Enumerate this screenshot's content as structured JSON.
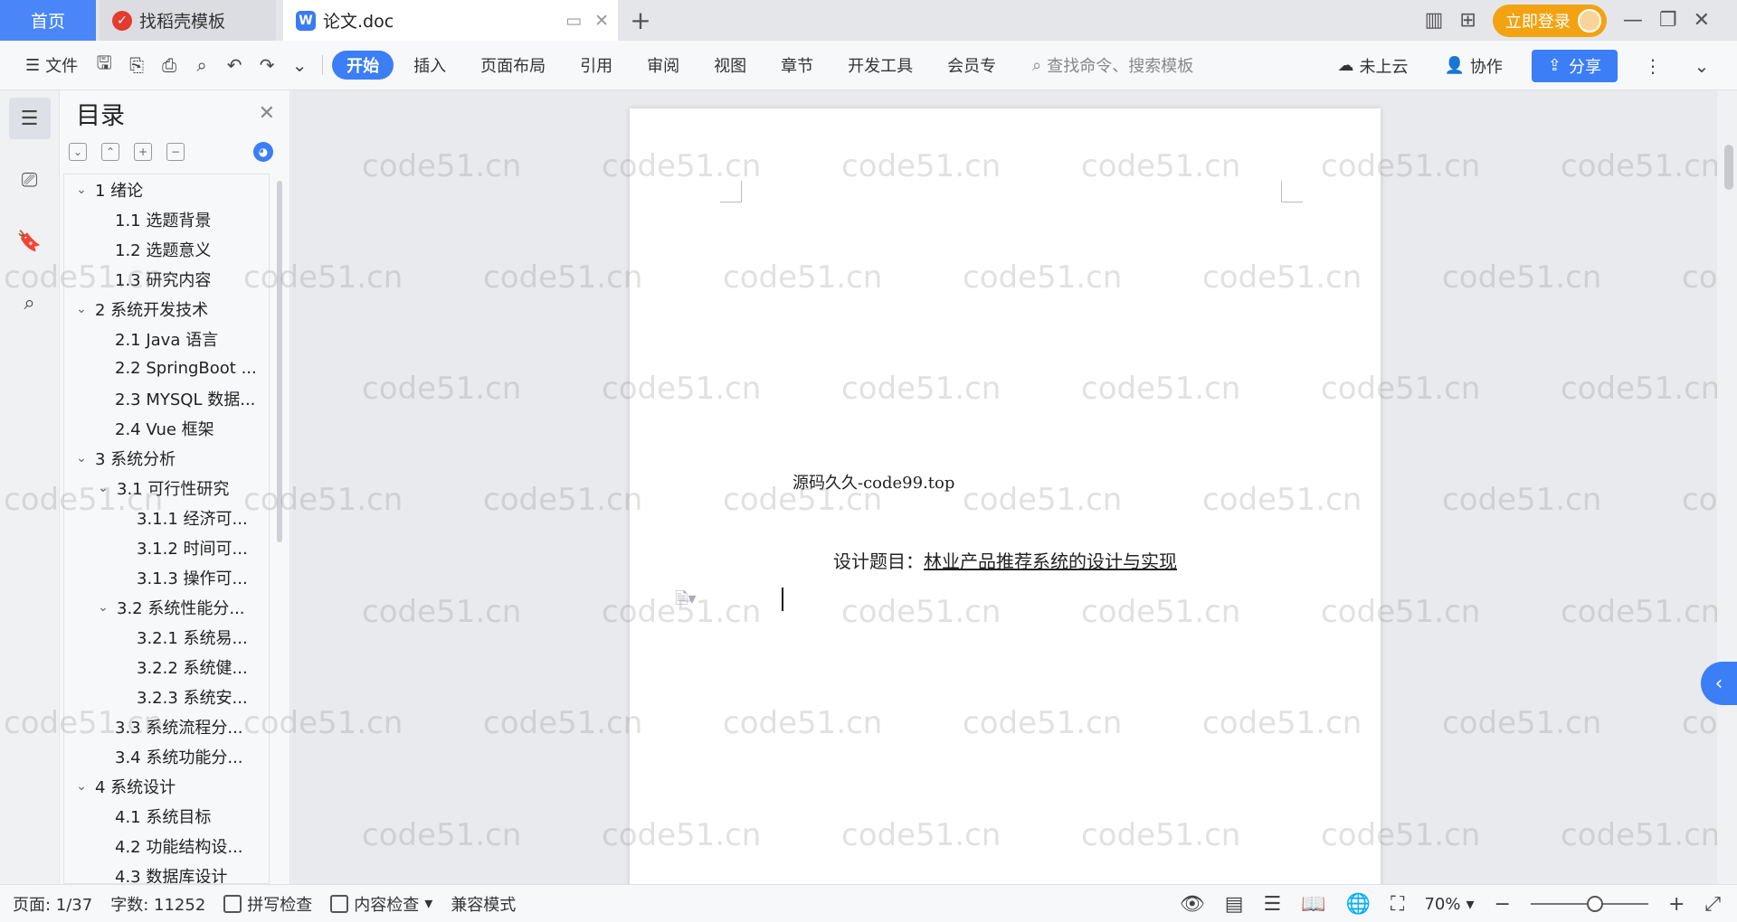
{
  "tabs": {
    "home": "首页",
    "template": "找稻壳模板",
    "doc": "论文.doc"
  },
  "titlebar": {
    "login": "立即登录"
  },
  "toolbar": {
    "file": "文件",
    "menu_tabs": [
      "开始",
      "插入",
      "页面布局",
      "引用",
      "审阅",
      "视图",
      "章节",
      "开发工具",
      "会员专"
    ],
    "search_placeholder": "查找命令、搜索模板",
    "cloud": "未上云",
    "collab": "协作",
    "share": "分享"
  },
  "toc": {
    "title": "目录",
    "items": [
      {
        "level": 1,
        "expanded": true,
        "text": "1  绪论"
      },
      {
        "level": 2,
        "text": "1.1  选题背景"
      },
      {
        "level": 2,
        "text": "1.2  选题意义"
      },
      {
        "level": 2,
        "text": "1.3  研究内容"
      },
      {
        "level": 1,
        "expanded": true,
        "text": "2  系统开发技术"
      },
      {
        "level": 2,
        "text": "2.1 Java 语言"
      },
      {
        "level": 2,
        "text": "2.2 SpringBoot ..."
      },
      {
        "level": 2,
        "text": "2.3 MYSQL 数据..."
      },
      {
        "level": 2,
        "text": "2.4 Vue 框架"
      },
      {
        "level": 1,
        "expanded": true,
        "text": "3  系统分析"
      },
      {
        "level": 2,
        "expanded": true,
        "text": "3.1 可行性研究"
      },
      {
        "level": 3,
        "text": "3.1.1 经济可..."
      },
      {
        "level": 3,
        "text": "3.1.2 时间可..."
      },
      {
        "level": 3,
        "text": "3.1.3 操作可..."
      },
      {
        "level": 2,
        "expanded": true,
        "text": "3.2 系统性能分..."
      },
      {
        "level": 3,
        "text": "3.2.1 系统易..."
      },
      {
        "level": 3,
        "text": "3.2.2 系统健..."
      },
      {
        "level": 3,
        "text": "3.2.3 系统安..."
      },
      {
        "level": 2,
        "text": "3.3  系统流程分..."
      },
      {
        "level": 2,
        "text": "3.4 系统功能分..."
      },
      {
        "level": 1,
        "expanded": true,
        "text": "4  系统设计"
      },
      {
        "level": 2,
        "text": "4.1 系统目标"
      },
      {
        "level": 2,
        "text": "4.2 功能结构设..."
      },
      {
        "level": 2,
        "text": "4.3 数据库设计"
      }
    ]
  },
  "document": {
    "line1": "源码久久-code99.top",
    "title_prefix": "设计题目：",
    "title_text": "林业产品推荐系统的设计与实现"
  },
  "watermark_text": "code51.cn",
  "status": {
    "page": "页面: 1/37",
    "words": "字数: 11252",
    "spell": "拼写检查",
    "content_check": "内容检查",
    "compat": "兼容模式",
    "zoom": "70%"
  }
}
